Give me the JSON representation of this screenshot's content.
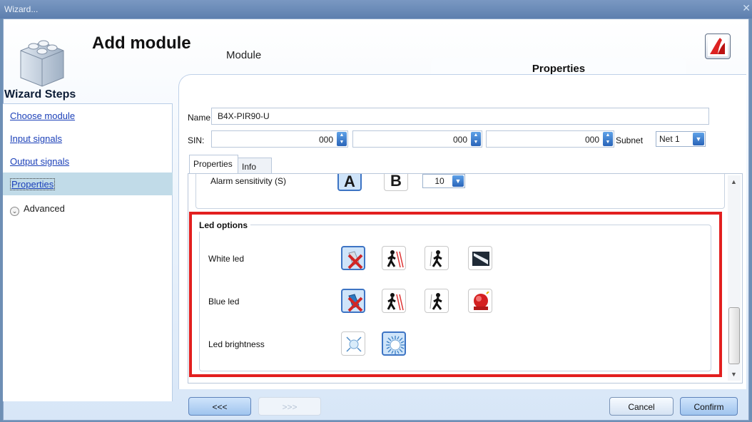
{
  "window": {
    "title": "Wizard..."
  },
  "header": {
    "title": "Add module",
    "subtitle": "Module"
  },
  "sidebar": {
    "title": "Wizard Steps",
    "items": [
      {
        "label": "Choose module"
      },
      {
        "label": "Input signals"
      },
      {
        "label": "Output signals"
      },
      {
        "label": "Properties",
        "selected": true
      }
    ],
    "advanced_label": "Advanced"
  },
  "content": {
    "section_title": "Properties",
    "name_label": "Name",
    "name_value": "B4X-PIR90-U",
    "sin_label": "SIN:",
    "sin_values": [
      "000",
      "000",
      "000"
    ],
    "subnet_label": "Subnet",
    "subnet_value": "Net 1",
    "tabs": [
      {
        "label": "Properties",
        "active": true
      },
      {
        "label": "Info",
        "active": false
      }
    ],
    "alarm_sensitivity_label": "Alarm sensitivity (S)",
    "alarm_options": [
      "A",
      "B"
    ],
    "alarm_value": "10",
    "led_options": {
      "legend": "Led options",
      "rows": [
        {
          "label": "White led",
          "selected_index": 0
        },
        {
          "label": "Blue led",
          "selected_index": 0
        },
        {
          "label": "Led brightness",
          "selected_index": 1
        }
      ]
    }
  },
  "footer": {
    "back_label": "<<<",
    "next_label": ">>>",
    "cancel_label": "Cancel",
    "confirm_label": "Confirm"
  },
  "colors": {
    "highlight_frame": "#e21f1f",
    "selection_bg": "#cfe4f9",
    "link": "#1a3fb8"
  }
}
